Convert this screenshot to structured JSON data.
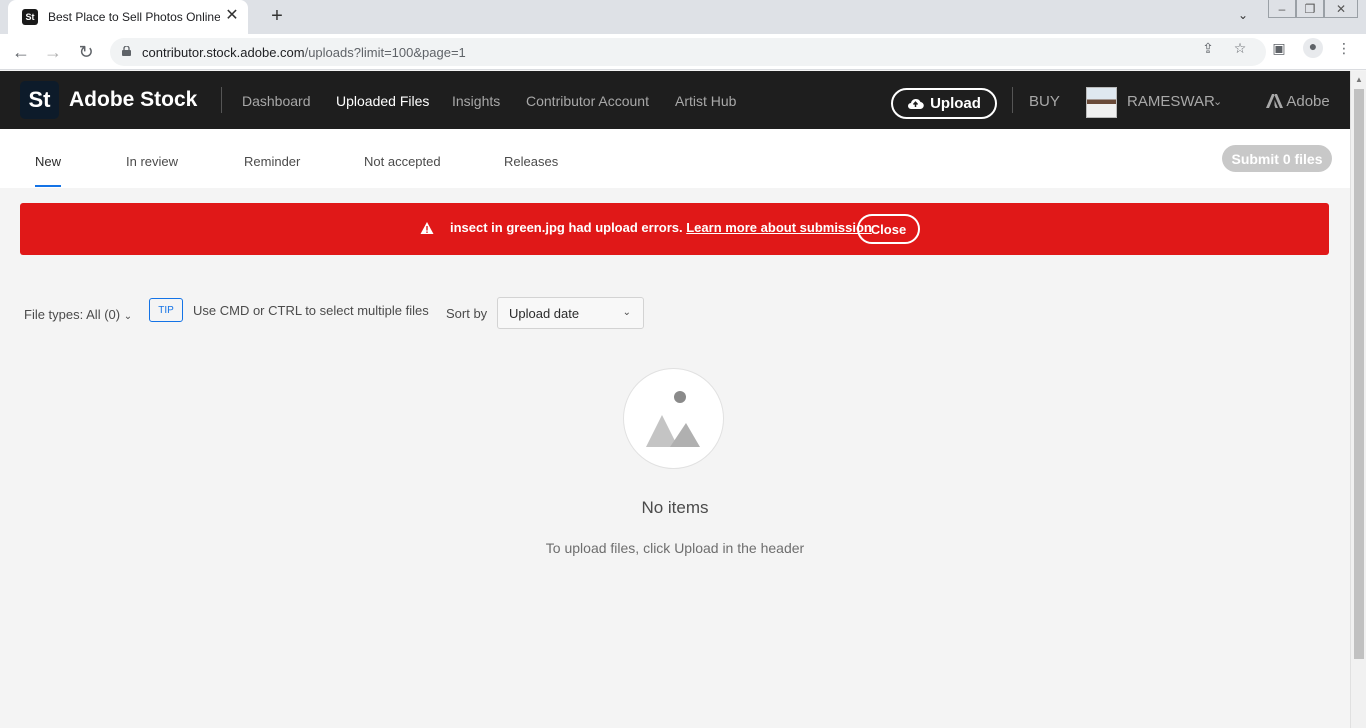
{
  "browser": {
    "tab_title": "Best Place to Sell Photos Online, ",
    "favicon": "St",
    "url_host": "contributor.stock.adobe.com",
    "url_path": "/uploads?limit=100&page=1"
  },
  "header": {
    "logo": "St",
    "brand": "Adobe Stock",
    "nav": [
      "Dashboard",
      "Uploaded Files",
      "Insights",
      "Contributor Account",
      "Artist Hub"
    ],
    "active_nav": "Uploaded Files",
    "upload_label": "Upload",
    "buy_label": "BUY",
    "username": "RAMESWAR",
    "adobe_label": "Adobe"
  },
  "subnav": {
    "tabs": [
      "New",
      "In review",
      "Reminder",
      "Not accepted",
      "Releases"
    ],
    "active_tab": "New",
    "submit_label": "Submit 0 files"
  },
  "banner": {
    "message": "insect in green.jpg had upload errors.",
    "link": "Learn more about submission",
    "close_label": "Close",
    "color": "#e01818"
  },
  "filters": {
    "file_types": "File types: All (0)",
    "tip_badge": "TIP",
    "tip_text": "Use CMD or CTRL to select multiple files",
    "sort_label": "Sort by",
    "sort_value": "Upload date"
  },
  "empty": {
    "title": "No items",
    "subtitle": "To upload files, click Upload in the header"
  },
  "colors": {
    "accent": "#1473e6",
    "header_bg": "#1e1e1e"
  }
}
